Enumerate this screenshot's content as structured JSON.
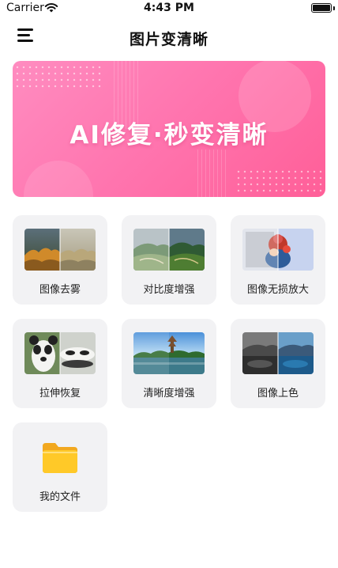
{
  "status_bar": {
    "carrier": "Carrier",
    "time": "4:43 PM"
  },
  "nav": {
    "title": "图片变清晰"
  },
  "banner": {
    "text": "AI修复·秒变清晰"
  },
  "tools": [
    {
      "label": "图像去雾",
      "icon": "defog-thumbnail-icon"
    },
    {
      "label": "对比度增强",
      "icon": "contrast-thumbnail-icon"
    },
    {
      "label": "图像无损放大",
      "icon": "upscale-thumbnail-icon"
    },
    {
      "label": "拉伸恢复",
      "icon": "stretch-thumbnail-icon"
    },
    {
      "label": "清晰度增强",
      "icon": "sharpen-thumbnail-icon"
    },
    {
      "label": "图像上色",
      "icon": "colorize-thumbnail-icon"
    },
    {
      "label": "我的文件",
      "icon": "folder-icon"
    }
  ],
  "colors": {
    "banner_start": "#ff8cc0",
    "banner_end": "#ff5f98",
    "tile_bg": "#f2f2f4",
    "folder": "#ffc928"
  }
}
